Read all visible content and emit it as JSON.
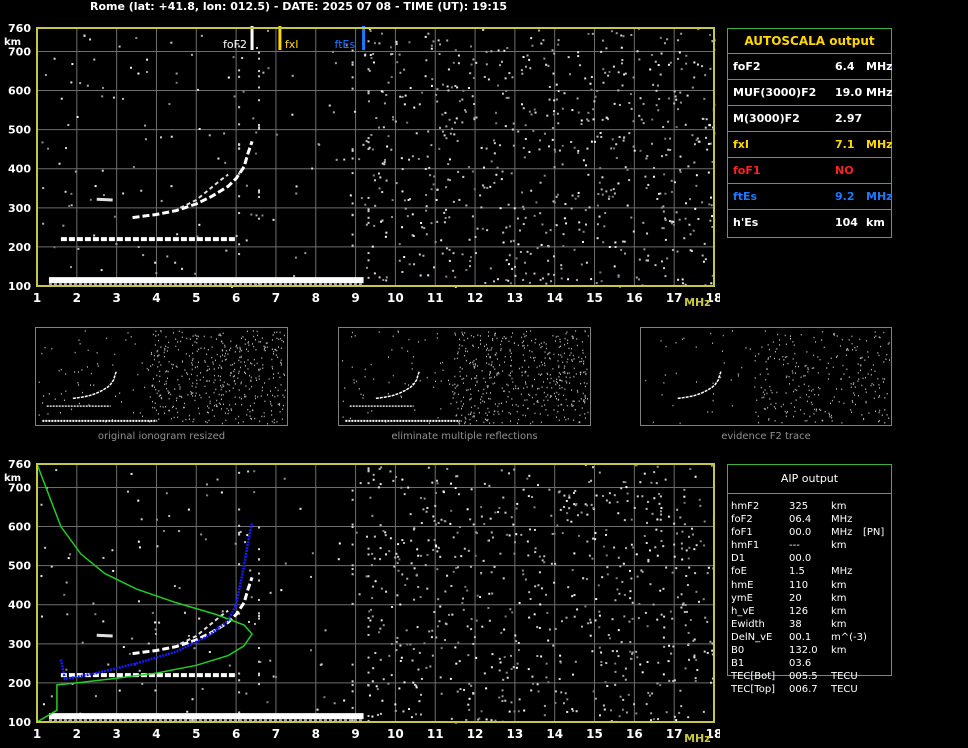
{
  "header": "Rome (lat: +41.8, lon: 012.5) - DATE: 2025 07 08 - TIME (UT): 19:15",
  "colors": {
    "frame": "#c8c840",
    "grid": "#6e6e6e",
    "panel_border": "#3cb43c",
    "foF2": "#ffffff",
    "fxI": "#ffd700",
    "foF1": "#ff2020",
    "ftEs": "#1e78ff",
    "profile": "#22cc22",
    "nh_profile": "#1a1aff"
  },
  "autoscala": {
    "title": "AUTOSCALA output",
    "rows": [
      {
        "label": "foF2",
        "value": "6.4",
        "unit": "MHz",
        "color": "#ffffff"
      },
      {
        "label": "MUF(3000)F2",
        "value": "19.0",
        "unit": "MHz",
        "color": "#ffffff"
      },
      {
        "label": "M(3000)F2",
        "value": "2.97",
        "unit": "",
        "color": "#ffffff"
      },
      {
        "label": "fxI",
        "value": "7.1",
        "unit": "MHz",
        "color": "#ffd700"
      },
      {
        "label": "foF1",
        "value": "NO",
        "unit": "",
        "color": "#ff2020"
      },
      {
        "label": "ftEs",
        "value": "9.2",
        "unit": "MHz",
        "color": "#1e78ff"
      },
      {
        "label": "h'Es",
        "value": "104",
        "unit": "km",
        "color": "#ffffff"
      }
    ]
  },
  "aip": {
    "title": "AIP output",
    "rows": [
      {
        "k": "hmF2",
        "v": "325",
        "u": "km",
        "x": ""
      },
      {
        "k": "foF2",
        "v": "06.4",
        "u": "MHz",
        "x": ""
      },
      {
        "k": "foF1",
        "v": "00.0",
        "u": "MHz",
        "x": "[PN]"
      },
      {
        "k": "hmF1",
        "v": "---",
        "u": "km",
        "x": ""
      },
      {
        "k": "D1",
        "v": "00.0",
        "u": "",
        "x": ""
      },
      {
        "k": "foE",
        "v": "1.5",
        "u": "MHz",
        "x": ""
      },
      {
        "k": "hmE",
        "v": "110",
        "u": "km",
        "x": ""
      },
      {
        "k": "ymE",
        "v": "20",
        "u": "km",
        "x": ""
      },
      {
        "k": "h_vE",
        "v": "126",
        "u": "km",
        "x": ""
      },
      {
        "k": "Ewidth",
        "v": "38",
        "u": "km",
        "x": ""
      },
      {
        "k": "DelN_vE",
        "v": "00.1",
        "u": "m^(-3)",
        "x": ""
      },
      {
        "k": "B0",
        "v": "132.0",
        "u": "km",
        "x": ""
      },
      {
        "k": "B1",
        "v": "03.6",
        "u": "",
        "x": ""
      },
      {
        "k": "TEC[Bot]",
        "v": "005.5",
        "u": "TECU",
        "x": ""
      },
      {
        "k": "TEC[Top]",
        "v": "006.7",
        "u": "TECU",
        "x": ""
      }
    ]
  },
  "thumbnails": [
    {
      "caption": "original ionogram resized"
    },
    {
      "caption": "eliminate multiple reflections"
    },
    {
      "caption": "evidence F2 trace"
    }
  ],
  "chart_data": [
    {
      "type": "scatter",
      "xlabel": "MHz",
      "ylabel": "km",
      "xlim": [
        1,
        18
      ],
      "ylim": [
        100,
        760
      ],
      "x_ticks": [
        1,
        2,
        3,
        4,
        5,
        6,
        7,
        8,
        9,
        10,
        11,
        12,
        13,
        14,
        15,
        16,
        17,
        18
      ],
      "y_ticks": [
        100,
        200,
        300,
        400,
        500,
        600,
        700,
        760
      ],
      "markers": [
        {
          "name": "foF2",
          "x": 6.4
        },
        {
          "name": "fxI",
          "x": 7.1
        },
        {
          "name": "ftEs",
          "x": 9.2
        }
      ],
      "traces": {
        "Es": {
          "x_start": 1.3,
          "x_end": 9.2,
          "h": 115
        },
        "Es_multiple": {
          "x_start": 1.6,
          "x_end": 6.0,
          "h": 220
        },
        "F2_ordinary": [
          [
            3.4,
            275
          ],
          [
            4.0,
            283
          ],
          [
            4.5,
            293
          ],
          [
            5.0,
            310
          ],
          [
            5.4,
            330
          ],
          [
            5.8,
            355
          ],
          [
            6.0,
            375
          ],
          [
            6.2,
            405
          ],
          [
            6.3,
            440
          ],
          [
            6.4,
            470
          ]
        ],
        "F2_extra": [
          [
            4.6,
            300
          ],
          [
            5.0,
            320
          ],
          [
            5.3,
            345
          ],
          [
            5.6,
            370
          ],
          [
            5.8,
            385
          ]
        ],
        "F2_spot": [
          [
            2.5,
            322
          ],
          [
            2.9,
            320
          ]
        ]
      }
    },
    {
      "type": "scatter",
      "xlabel": "MHz",
      "ylabel": "km",
      "xlim": [
        1,
        18
      ],
      "ylim": [
        100,
        760
      ],
      "x_ticks": [
        1,
        2,
        3,
        4,
        5,
        6,
        7,
        8,
        9,
        10,
        11,
        12,
        13,
        14,
        15,
        16,
        17,
        18
      ],
      "y_ticks": [
        100,
        200,
        300,
        400,
        500,
        600,
        700,
        760
      ],
      "series": [
        {
          "name": "electron density profile",
          "values": [
            [
              1.0,
              100
            ],
            [
              1.2,
              112
            ],
            [
              1.5,
              130
            ],
            [
              1.5,
              195
            ],
            [
              2.0,
              200
            ],
            [
              3.0,
              212
            ],
            [
              4.0,
              225
            ],
            [
              5.0,
              245
            ],
            [
              5.8,
              270
            ],
            [
              6.2,
              295
            ],
            [
              6.4,
              325
            ],
            [
              6.2,
              348
            ],
            [
              5.5,
              375
            ],
            [
              4.5,
              405
            ],
            [
              3.5,
              440
            ],
            [
              2.7,
              480
            ],
            [
              2.1,
              530
            ],
            [
              1.6,
              600
            ],
            [
              1.3,
              680
            ],
            [
              1.0,
              760
            ]
          ]
        },
        {
          "name": "true height profile",
          "values": [
            [
              1.6,
              260
            ],
            [
              1.7,
              210
            ],
            [
              2.5,
              225
            ],
            [
              3.5,
              250
            ],
            [
              4.5,
              280
            ],
            [
              5.3,
              320
            ],
            [
              5.8,
              360
            ],
            [
              6.0,
              400
            ],
            [
              6.1,
              450
            ],
            [
              6.2,
              500
            ],
            [
              6.3,
              560
            ],
            [
              6.4,
              610
            ]
          ]
        }
      ]
    }
  ]
}
